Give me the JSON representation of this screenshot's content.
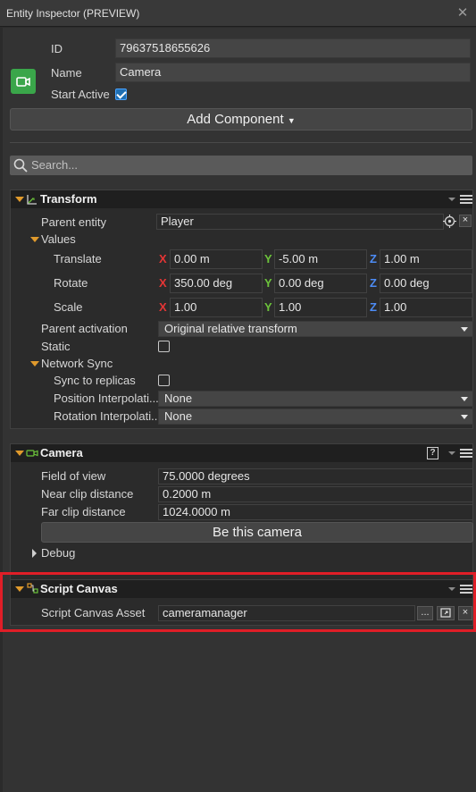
{
  "window": {
    "title": "Entity Inspector (PREVIEW)"
  },
  "entity": {
    "id_label": "ID",
    "id_value": "79637518655626",
    "name_label": "Name",
    "name_value": "Camera",
    "start_active_label": "Start Active",
    "start_active": true,
    "icon": "camera-icon"
  },
  "add_component_label": "Add Component",
  "search": {
    "placeholder": "Search..."
  },
  "transform": {
    "title": "Transform",
    "parent_entity_label": "Parent entity",
    "parent_entity_value": "Player",
    "values_label": "Values",
    "translate_label": "Translate",
    "translate": {
      "x": "0.00 m",
      "y": "-5.00 m",
      "z": "1.00 m"
    },
    "rotate_label": "Rotate",
    "rotate": {
      "x": "350.00 deg",
      "y": "0.00 deg",
      "z": "0.00 deg"
    },
    "scale_label": "Scale",
    "scale": {
      "x": "1.00",
      "y": "1.00",
      "z": "1.00"
    },
    "axis_x": "X",
    "axis_y": "Y",
    "axis_z": "Z",
    "parent_activation_label": "Parent activation",
    "parent_activation_value": "Original relative transform",
    "static_label": "Static",
    "static": false,
    "network_sync_label": "Network Sync",
    "sync_replicas_label": "Sync to replicas",
    "sync_replicas": false,
    "pos_interp_label": "Position Interpolati...",
    "pos_interp_value": "None",
    "rot_interp_label": "Rotation Interpolati...",
    "rot_interp_value": "None"
  },
  "camera": {
    "title": "Camera",
    "help_glyph": "?",
    "fov_label": "Field of view",
    "fov_value": "75.0000 degrees",
    "near_label": "Near clip distance",
    "near_value": "0.2000 m",
    "far_label": "Far clip distance",
    "far_value": "1024.0000 m",
    "be_this_label": "Be this camera",
    "debug_label": "Debug"
  },
  "script_canvas": {
    "title": "Script Canvas",
    "asset_label": "Script Canvas Asset",
    "asset_value": "cameramanager",
    "browse_label": "...",
    "clear_glyph": "×"
  },
  "colors": {
    "highlight": "#e01e27",
    "accent_orange": "#e09a2c",
    "checkbox_blue": "#1f6fb3"
  }
}
